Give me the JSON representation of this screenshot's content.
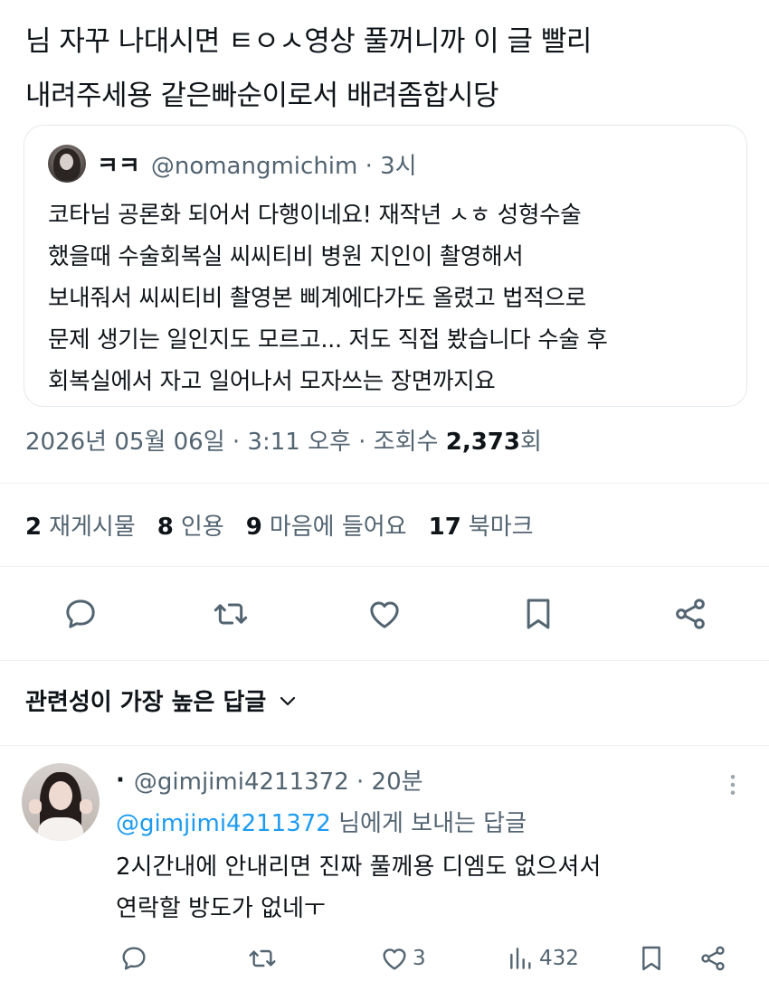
{
  "tweet": {
    "text_line1": "님 자꾸 나대시면 ㅌㅇㅅ영상 풀꺼니까 이 글 빨리",
    "text_line2": "내려주세용 같은빠순이로서 배려좀합시당",
    "quote": {
      "name": "ㅋㅋ",
      "handle_time": "@nomangmichim · 3시",
      "lines": [
        "코타님 공론화 되어서 다행이네요! 재작년 ㅅㅎ 성형수술",
        "했을때 수술회복실 씨씨티비 병원 지인이 촬영해서",
        "보내줘서 씨씨티비 촬영본 삐계에다가도 올렸고 법적으로",
        "문제 생기는 일인지도 모르고... 저도 직접 봤습니다 수술 후",
        "회복실에서 자고 일어나서 모자쓰는 장면까지요"
      ]
    },
    "meta_prefix": "2026년 05월 06일 · 3:11 오후 · 조회수 ",
    "views": "2,373",
    "views_suffix": "회",
    "stats": [
      {
        "num": "2",
        "label": "재게시물"
      },
      {
        "num": "8",
        "label": "인용"
      },
      {
        "num": "9",
        "label": "마음에 들어요"
      },
      {
        "num": "17",
        "label": "북마크"
      }
    ]
  },
  "actions": {
    "reply_icon": "reply-icon",
    "retweet_icon": "retweet-icon",
    "like_icon": "heart-icon",
    "bookmark_icon": "bookmark-icon",
    "share_icon": "share-icon"
  },
  "sort_label": "관련성이 가장 높은 답글",
  "reply": {
    "name": "·",
    "handle_time": "@gimjimi4211372 · 20분",
    "reply_to_mention": "@gimjimi4211372",
    "reply_to_suffix": " 님에게 보내는 답글",
    "line1": "2시간내에 안내리면 진짜 풀께용 디엠도 없으셔서",
    "line2": "연락할 방도가 없네ㅜ",
    "likes": "3",
    "views": "432"
  },
  "colors": {
    "text": "#0f1419",
    "secondary": "#536471",
    "accent": "#1d9bf0",
    "border": "#eff3f4"
  }
}
